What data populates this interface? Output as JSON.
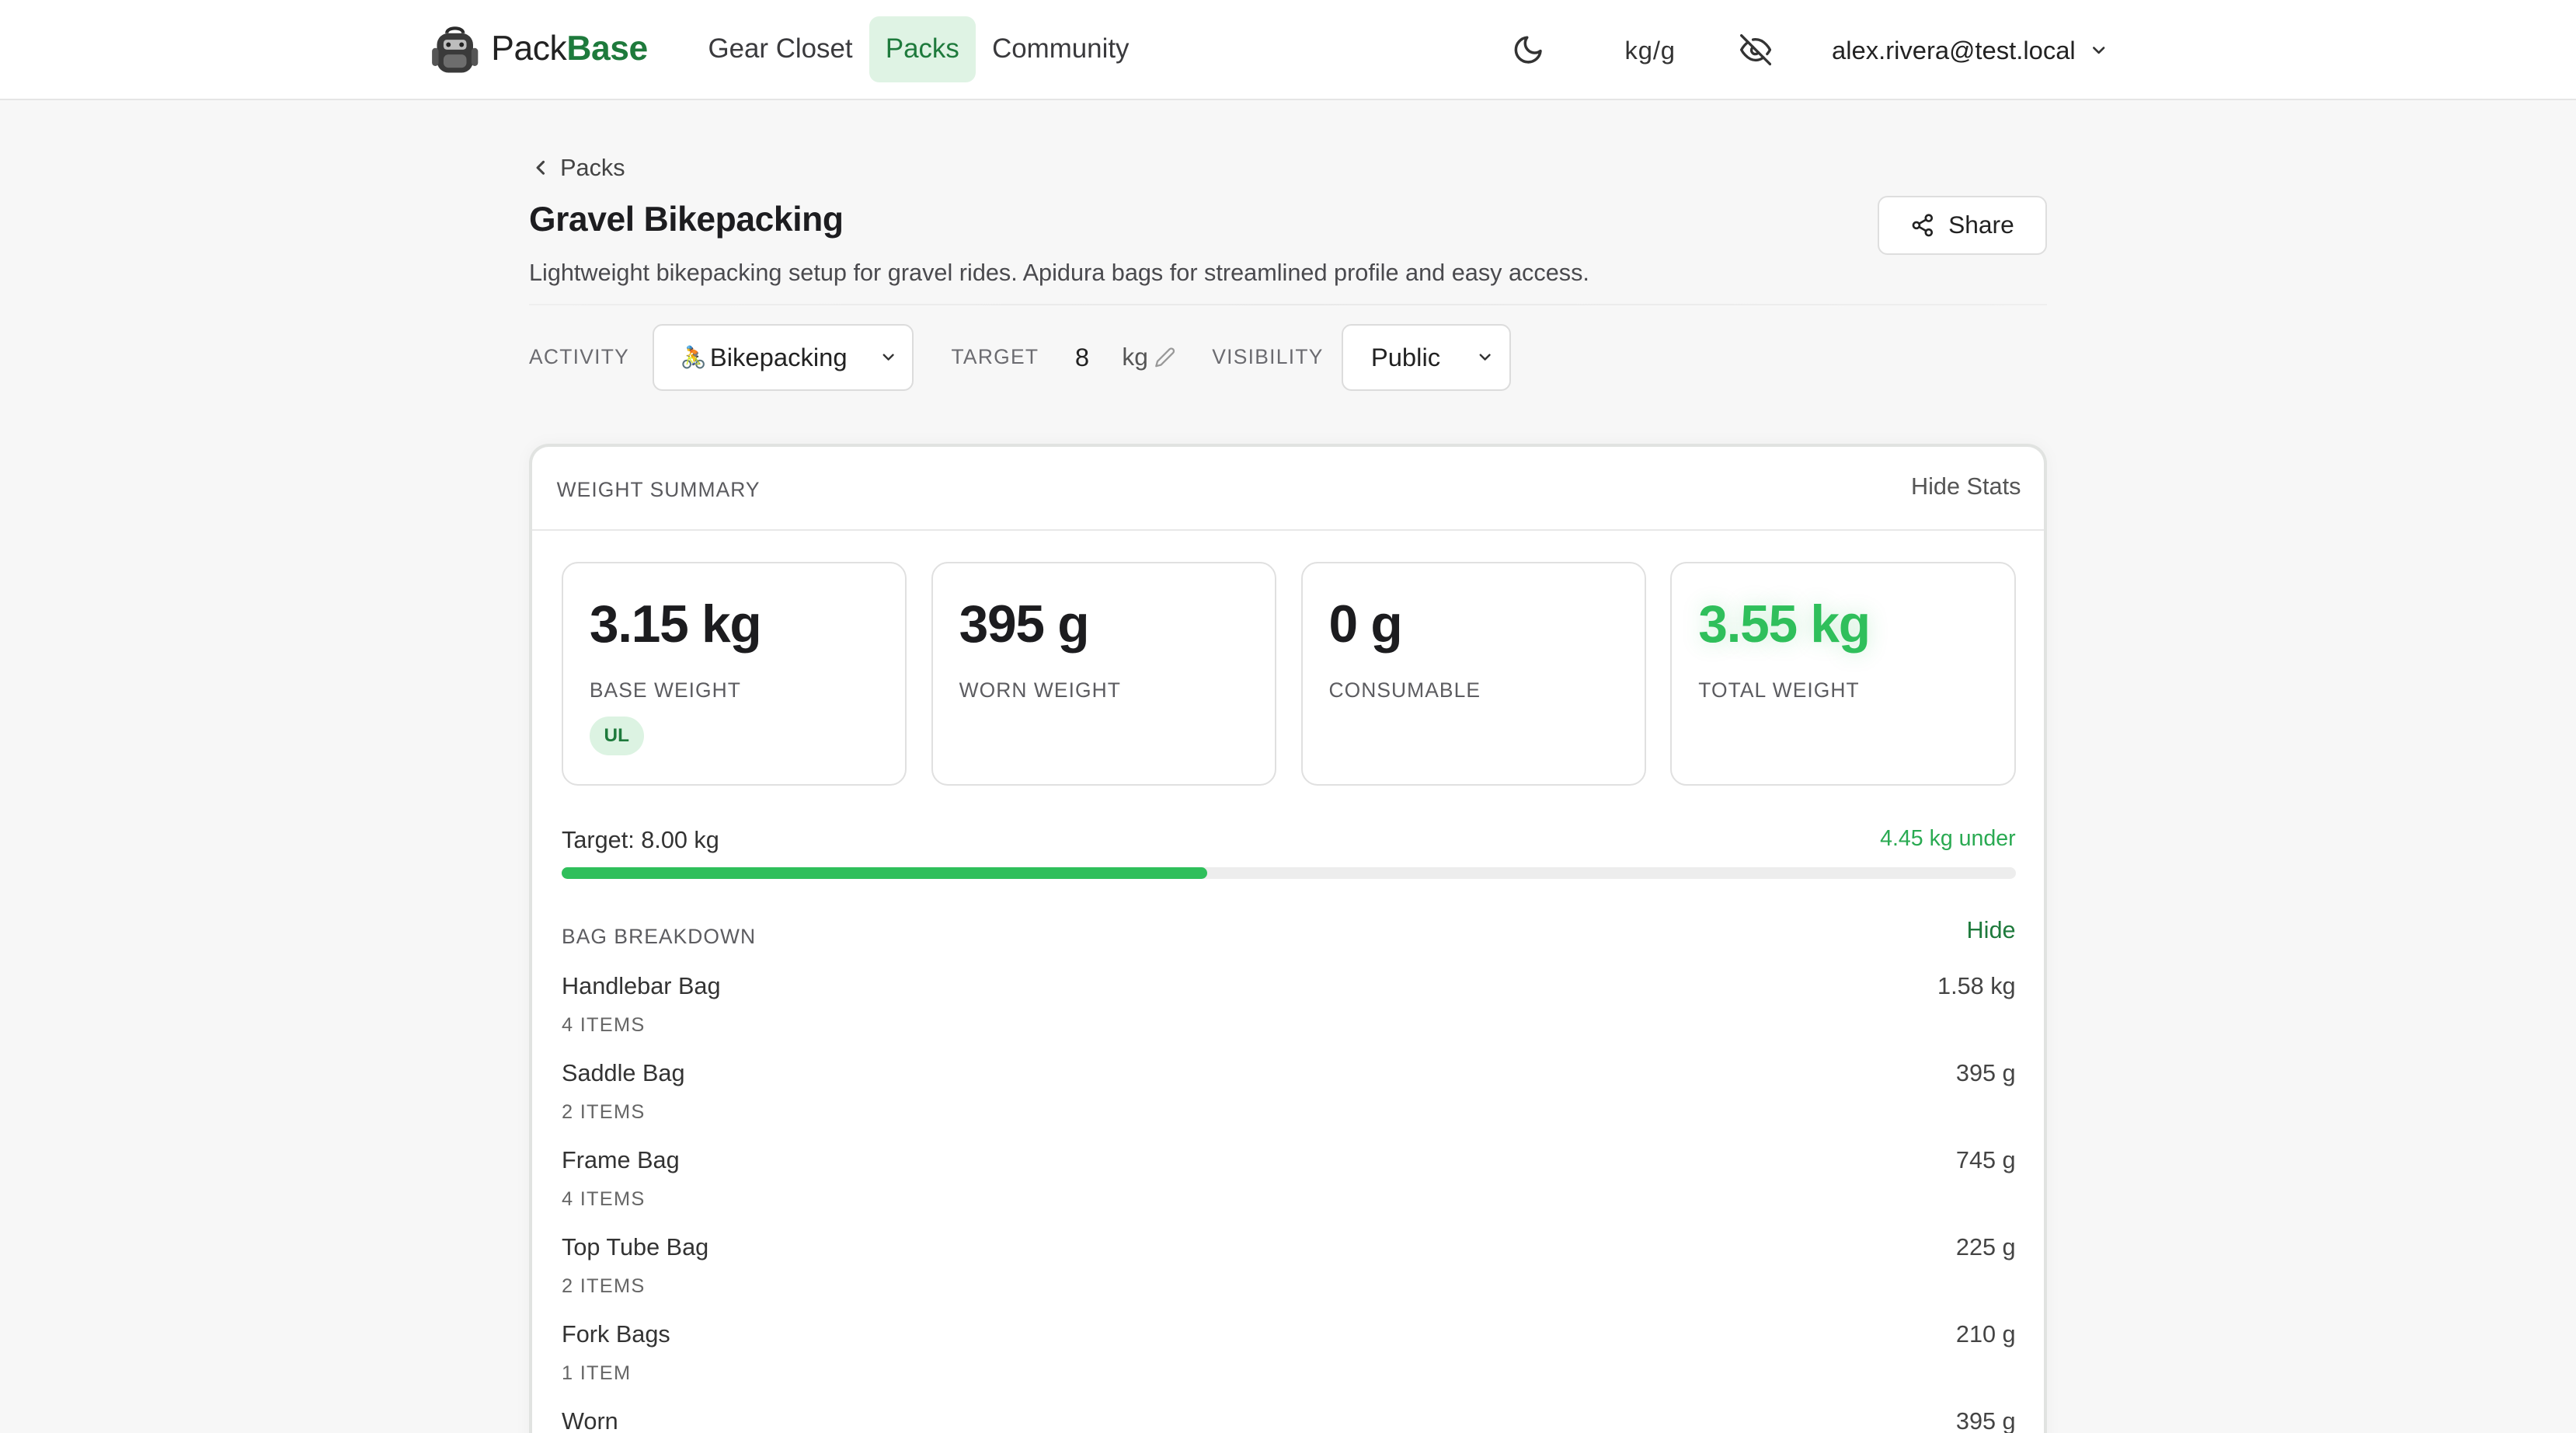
{
  "brand": {
    "name_plain": "Pack",
    "name_bold": "Base",
    "logo_icon": "backpack-icon"
  },
  "nav": [
    {
      "label": "Gear Closet",
      "active": false
    },
    {
      "label": "Packs",
      "active": true
    },
    {
      "label": "Community",
      "active": false
    }
  ],
  "header": {
    "theme_icon": "moon-icon",
    "units_label": "kg/g",
    "privacy_icon": "eye-off-icon",
    "user_email": "alex.rivera@test.local"
  },
  "breadcrumb": {
    "label": "Packs"
  },
  "pack": {
    "title": "Gravel Bikepacking",
    "description": "Lightweight bikepacking setup for gravel rides. Apidura bags for streamlined profile and easy access.",
    "share_label": "Share",
    "activity_label": "ACTIVITY",
    "activity_emoji": "🚴",
    "activity_value": "Bikepacking",
    "target_label": "TARGET",
    "target_value": "8",
    "target_unit": "kg",
    "visibility_label": "VISIBILITY",
    "visibility_value": "Public"
  },
  "summary": {
    "title": "WEIGHT SUMMARY",
    "hide_stats_label": "Hide Stats",
    "stats": [
      {
        "value": "3.15 kg",
        "label": "BASE WEIGHT",
        "badge": "UL"
      },
      {
        "value": "395 g",
        "label": "WORN WEIGHT"
      },
      {
        "value": "0 g",
        "label": "CONSUMABLE"
      },
      {
        "value": "3.55 kg",
        "label": "TOTAL WEIGHT",
        "accent": "#2fbf5b"
      }
    ],
    "target_text": "Target: 8.00 kg",
    "under_text": "4.45 kg under",
    "progress_fraction": 0.444,
    "bag_breakdown_title": "BAG BREAKDOWN",
    "bag_breakdown_hide": "Hide",
    "bags": [
      {
        "name": "Handlebar Bag",
        "count": "4 ITEMS",
        "weight": "1.58 kg"
      },
      {
        "name": "Saddle Bag",
        "count": "2 ITEMS",
        "weight": "395 g"
      },
      {
        "name": "Frame Bag",
        "count": "4 ITEMS",
        "weight": "745 g"
      },
      {
        "name": "Top Tube Bag",
        "count": "2 ITEMS",
        "weight": "225 g"
      },
      {
        "name": "Fork Bags",
        "count": "1 ITEM",
        "weight": "210 g"
      },
      {
        "name": "Worn",
        "count": "",
        "weight": "395 g"
      }
    ]
  },
  "colors": {
    "brand_green": "#1e7a3c",
    "accent_green": "#2fbf5b",
    "nav_active_bg": "#dff3e4"
  }
}
